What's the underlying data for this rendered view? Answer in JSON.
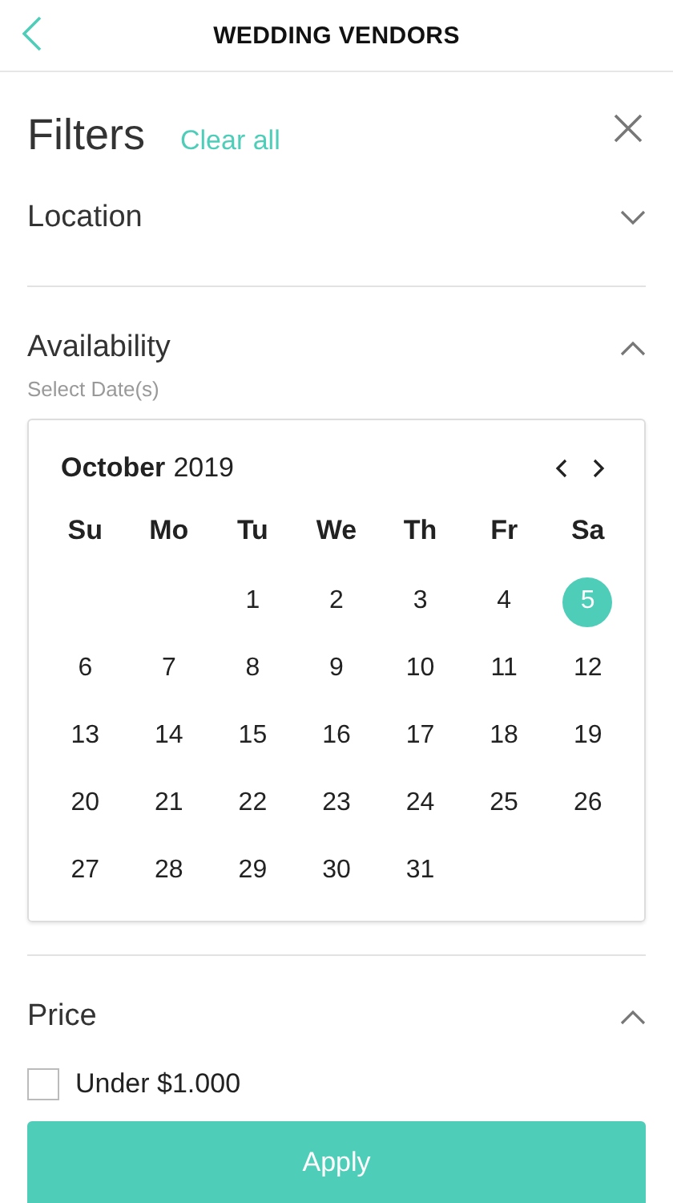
{
  "header": {
    "title": "WEDDING VENDORS"
  },
  "filters": {
    "title": "Filters",
    "clear_label": "Clear all"
  },
  "sections": [
    {
      "kind": "plain",
      "title": "Location",
      "expanded": false
    },
    {
      "kind": "calendar",
      "title": "Availability",
      "expanded": true,
      "hint": "Select Date(s)",
      "calendar": {
        "month": "October",
        "year": "2019",
        "weekdays": [
          "Su",
          "Mo",
          "Tu",
          "We",
          "Th",
          "Fr",
          "Sa"
        ],
        "weeks": [
          {
            "kind": "first",
            "days": [
              {
                "label": "1",
                "selected": false
              },
              {
                "label": "2",
                "selected": false
              },
              {
                "label": "3",
                "selected": false
              },
              {
                "label": "4",
                "selected": false
              },
              {
                "label": "5",
                "selected": true
              }
            ]
          },
          {
            "kind": "full",
            "days": [
              {
                "label": "6",
                "selected": false
              },
              {
                "label": "7",
                "selected": false
              },
              {
                "label": "8",
                "selected": false
              },
              {
                "label": "9",
                "selected": false
              },
              {
                "label": "10",
                "selected": false
              },
              {
                "label": "11",
                "selected": false
              },
              {
                "label": "12",
                "selected": false
              }
            ]
          },
          {
            "kind": "full",
            "days": [
              {
                "label": "13",
                "selected": false
              },
              {
                "label": "14",
                "selected": false
              },
              {
                "label": "15",
                "selected": false
              },
              {
                "label": "16",
                "selected": false
              },
              {
                "label": "17",
                "selected": false
              },
              {
                "label": "18",
                "selected": false
              },
              {
                "label": "19",
                "selected": false
              }
            ]
          },
          {
            "kind": "full",
            "days": [
              {
                "label": "20",
                "selected": false
              },
              {
                "label": "21",
                "selected": false
              },
              {
                "label": "22",
                "selected": false
              },
              {
                "label": "23",
                "selected": false
              },
              {
                "label": "24",
                "selected": false
              },
              {
                "label": "25",
                "selected": false
              },
              {
                "label": "26",
                "selected": false
              }
            ]
          },
          {
            "kind": "last",
            "days": [
              {
                "label": "27",
                "selected": false
              },
              {
                "label": "28",
                "selected": false
              },
              {
                "label": "29",
                "selected": false
              },
              {
                "label": "30",
                "selected": false
              },
              {
                "label": "31",
                "selected": false
              }
            ]
          }
        ]
      }
    },
    {
      "kind": "options",
      "title": "Price",
      "expanded": true,
      "options": [
        {
          "label": "Under $1.000",
          "checked": false
        }
      ]
    }
  ],
  "apply_button": {
    "label": "Apply"
  }
}
